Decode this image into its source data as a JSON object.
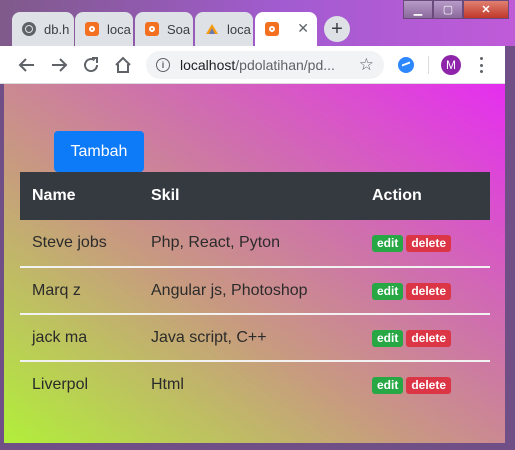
{
  "browser": {
    "tabs": [
      {
        "label": "db.h",
        "icon": "globe-icon",
        "active": false
      },
      {
        "label": "loca",
        "icon": "xampp-icon",
        "active": false
      },
      {
        "label": "Soa",
        "icon": "xampp-icon",
        "active": false
      },
      {
        "label": "loca",
        "icon": "phpmyadmin-icon",
        "active": false
      },
      {
        "label": "",
        "icon": "xampp-icon",
        "active": true
      }
    ],
    "close_glyph": "✕",
    "new_tab_glyph": "+",
    "url_host": "localhost",
    "url_path": "/pdolatihan/pd...",
    "avatar_letter": "M",
    "window_controls": {
      "minimize": "▁",
      "maximize": "▢",
      "close": "✕"
    }
  },
  "page": {
    "add_button": "Tambah",
    "table": {
      "headers": [
        "Name",
        "Skil",
        "Action"
      ],
      "rows": [
        {
          "name": "Steve jobs",
          "skill": "Php, React, Pyton"
        },
        {
          "name": "Marq z",
          "skill": "Angular js, Photoshop"
        },
        {
          "name": "jack ma",
          "skill": "Java script, C++"
        },
        {
          "name": "Liverpol",
          "skill": "Html"
        }
      ],
      "edit_label": "edit",
      "delete_label": "delete"
    }
  },
  "colors": {
    "primary": "#0d7af7",
    "header_dark": "#343a40",
    "edit": "#28a745",
    "delete": "#dc3545"
  }
}
